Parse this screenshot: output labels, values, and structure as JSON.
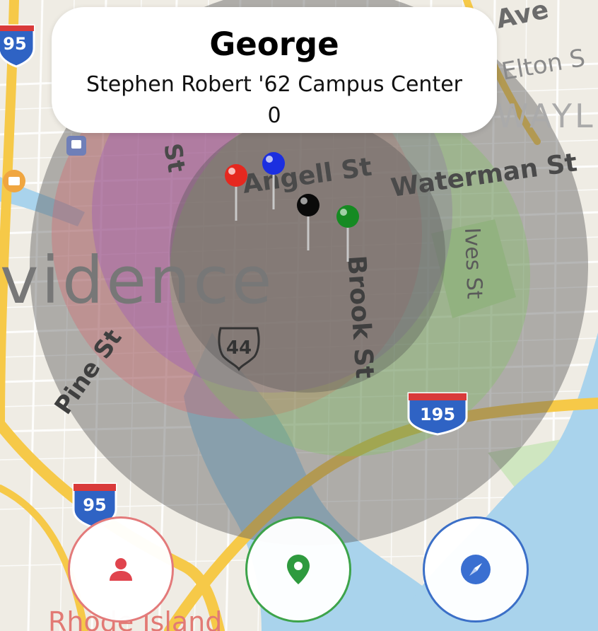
{
  "info_card": {
    "name": "George",
    "place": "Stephen Robert '62 Campus Center",
    "count": "0"
  },
  "map": {
    "labels": {
      "ave": "Ave",
      "elton": "Elton S",
      "wayl": "WAYL",
      "angell": "Angell St",
      "waterman": "Waterman St",
      "st_left": "St",
      "ives": "Ives St",
      "brook": "Brook St",
      "vidence": "vidence",
      "pine": "Pine St",
      "rhode_island": "Rhode Island"
    },
    "shields": {
      "i95_top": "95",
      "i95_bottom": "95",
      "us44": "44",
      "i195": "195"
    },
    "pins": [
      {
        "color": "#e5281f",
        "name": "red-pin"
      },
      {
        "color": "#1b2fe0",
        "name": "blue-pin"
      },
      {
        "color": "#0a0a0a",
        "name": "black-pin"
      },
      {
        "color": "#168a22",
        "name": "green-pin"
      }
    ],
    "colors": {
      "water": "#a9d3ec",
      "park": "#cfe6c0",
      "highway": "#f6c948",
      "range_gray": "rgba(95,95,95,0.45)",
      "range_red": "rgba(226,85,95,0.30)",
      "range_purple": "rgba(142,70,200,0.28)",
      "range_green": "rgba(120,200,80,0.28)",
      "range_inner": "rgba(80,80,80,0.35)"
    }
  },
  "buttons": {
    "user": {
      "icon": "user-icon",
      "color": "#e0444d"
    },
    "pin": {
      "icon": "map-pin-icon",
      "color": "#2e9a3e"
    },
    "compass": {
      "icon": "compass-icon",
      "color": "#3a6fd1"
    }
  }
}
